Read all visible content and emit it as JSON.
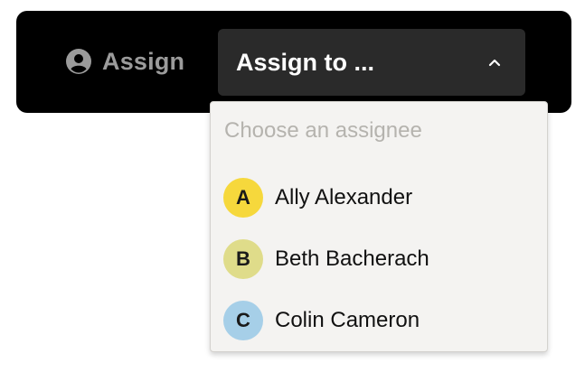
{
  "toolbar": {
    "assign_label": "Assign",
    "select_value": "Assign to ...",
    "user_icon": "user-circle-icon",
    "chevron_icon": "chevron-up-icon"
  },
  "dropdown": {
    "placeholder": "Choose an assignee",
    "options": [
      {
        "initial": "A",
        "name": "Ally Alexander",
        "color": "#f6d83c"
      },
      {
        "initial": "B",
        "name": "Beth Bacherach",
        "color": "#dfdc8a"
      },
      {
        "initial": "C",
        "name": "Colin Cameron",
        "color": "#a6cfe8"
      }
    ]
  },
  "colors": {
    "toolbar_bg": "#000000",
    "select_bg": "#2a2a2a",
    "dropdown_bg": "#f4f3f1"
  }
}
